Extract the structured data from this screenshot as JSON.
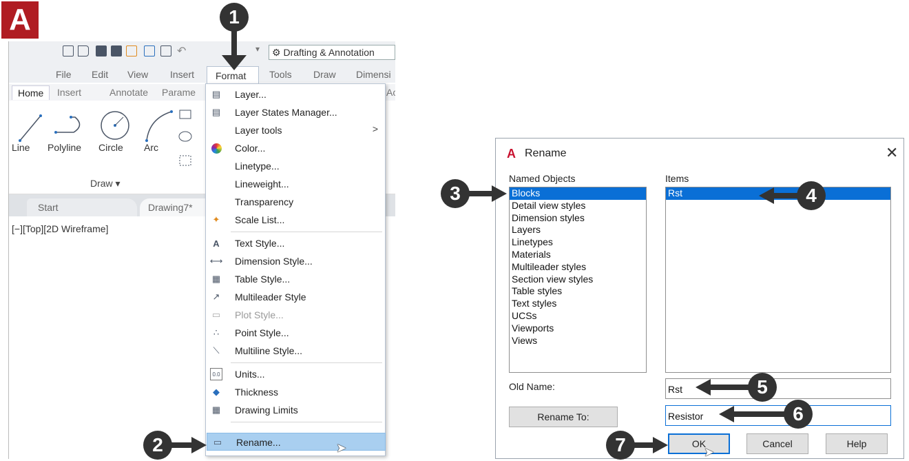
{
  "app": {
    "workspace": "Drafting & Annotation",
    "menus": [
      "File",
      "Edit",
      "View",
      "Insert",
      "Format",
      "Tools",
      "Draw",
      "Dimensi"
    ],
    "ribbon_tabs": [
      "Home",
      "Insert",
      "Annotate",
      "Parame",
      "Ac"
    ],
    "tools": [
      "Line",
      "Polyline",
      "Circle",
      "Arc"
    ],
    "panel_label": "Draw ▾",
    "doc_tabs": [
      "Start",
      "Drawing7*"
    ],
    "viewport_label": "[−][Top][2D Wireframe]"
  },
  "format_menu": {
    "items": [
      {
        "label": "Layer...",
        "icon": "layer-icon"
      },
      {
        "label": "Layer States Manager...",
        "icon": "layer-states-icon"
      },
      {
        "label": "Layer tools",
        "icon": "",
        "submenu": ">"
      },
      {
        "label": "Color...",
        "icon": "color-wheel-icon"
      },
      {
        "label": "Linetype...",
        "icon": ""
      },
      {
        "label": "Lineweight...",
        "icon": ""
      },
      {
        "label": "Transparency",
        "icon": ""
      },
      {
        "label": "Scale List...",
        "icon": "scale-list-icon"
      },
      {
        "label": "Text Style...",
        "icon": "text-style-icon"
      },
      {
        "label": "Dimension Style...",
        "icon": "dimension-style-icon"
      },
      {
        "label": "Table Style...",
        "icon": "table-style-icon"
      },
      {
        "label": "Multileader Style",
        "icon": "multileader-style-icon"
      },
      {
        "label": "Plot Style...",
        "icon": "plot-style-icon",
        "disabled": true
      },
      {
        "label": "Point Style...",
        "icon": "point-style-icon"
      },
      {
        "label": "Multiline Style...",
        "icon": "multiline-style-icon"
      },
      {
        "label": "Units...",
        "icon": "units-icon"
      },
      {
        "label": "Thickness",
        "icon": "thickness-icon"
      },
      {
        "label": "Drawing Limits",
        "icon": "drawing-limits-icon"
      },
      {
        "label": "Rename...",
        "icon": "rename-icon",
        "selected": true
      }
    ]
  },
  "dialog": {
    "title": "Rename",
    "named_objects_label": "Named Objects",
    "items_label": "Items",
    "named_objects": [
      "Blocks",
      "Detail view styles",
      "Dimension styles",
      "Layers",
      "Linetypes",
      "Materials",
      "Multileader styles",
      "Section view styles",
      "Table styles",
      "Text styles",
      "UCSs",
      "Viewports",
      "Views"
    ],
    "selected_named_object": "Blocks",
    "items": [
      "Rst"
    ],
    "old_name_label": "Old Name:",
    "old_name_value": "Rst",
    "rename_to_label": "Rename To:",
    "rename_to_value": "Resistor",
    "ok_label": "OK",
    "cancel_label": "Cancel",
    "help_label": "Help"
  },
  "callouts": [
    "1",
    "2",
    "3",
    "4",
    "5",
    "6",
    "7"
  ]
}
